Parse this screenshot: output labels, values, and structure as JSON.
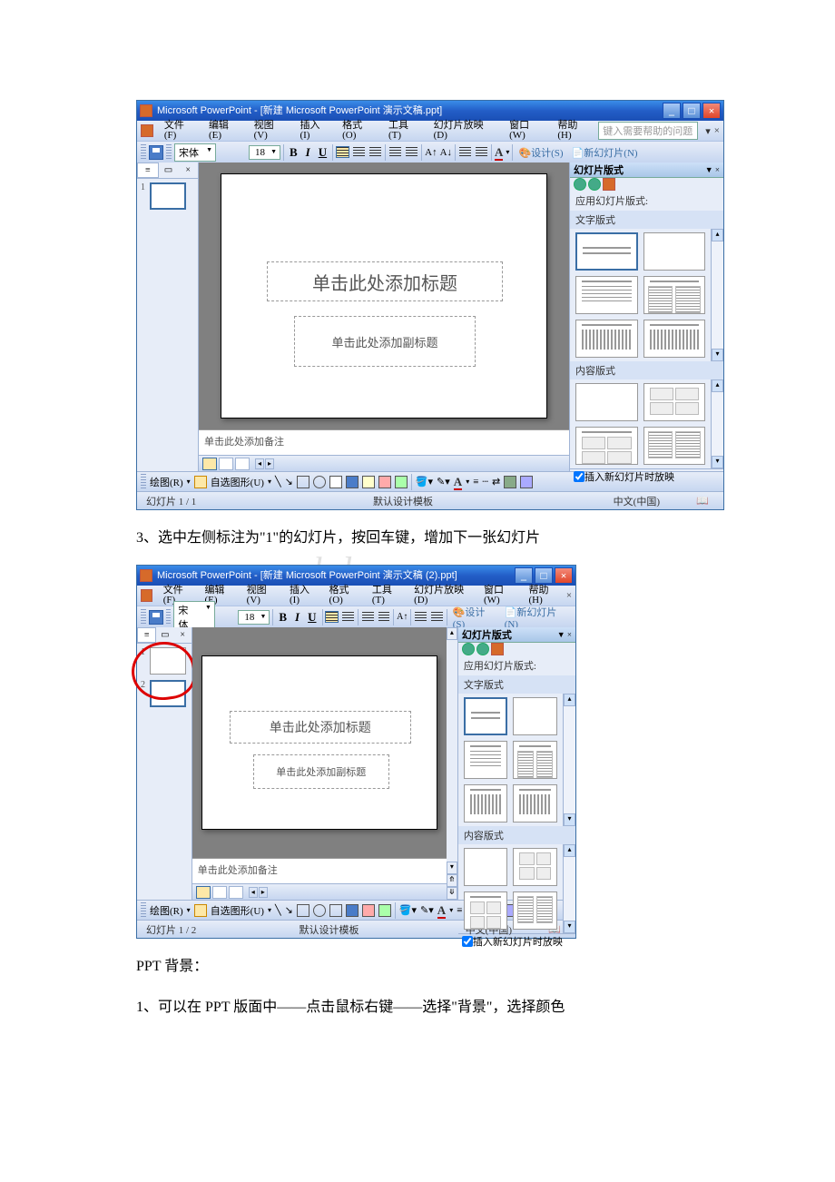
{
  "watermark": "www.bdocx.com",
  "body": {
    "line1": "3、选中左侧标注为\"1\"的幻灯片，按回车键，增加下一张幻灯片",
    "line2": "PPT 背景：",
    "line3": "1、可以在 PPT 版面中——点击鼠标右键——选择\"背景\"，选择颜色"
  },
  "ppt1": {
    "title": "Microsoft PowerPoint - [新建 Microsoft PowerPoint 演示文稿.ppt]",
    "menus": [
      "文件(F)",
      "编辑(E)",
      "视图(V)",
      "插入(I)",
      "格式(O)",
      "工具(T)",
      "幻灯片放映(D)",
      "窗口(W)",
      "帮助(H)"
    ],
    "help_placeholder": "键入需要帮助的问题",
    "font_name": "宋体",
    "font_size": "18",
    "design_btn": "设计(S)",
    "newslide_btn": "新幻灯片(N)",
    "taskpane_title": "幻灯片版式",
    "apply_label": "应用幻灯片版式:",
    "section_text": "文字版式",
    "section_content": "内容版式",
    "insert_check": "插入新幻灯片时放映",
    "thumb1_num": "1",
    "slide_title_ph": "单击此处添加标题",
    "slide_sub_ph": "单击此处添加副标题",
    "notes_ph": "单击此处添加备注",
    "draw_label": "绘图(R)",
    "autoshape_label": "自选图形(U)",
    "status_slide": "幻灯片 1 / 1",
    "status_template": "默认设计模板",
    "status_lang": "中文(中国)"
  },
  "ppt2": {
    "title": "Microsoft PowerPoint - [新建 Microsoft PowerPoint 演示文稿 (2).ppt]",
    "menus": [
      "文件(F)",
      "编辑(E)",
      "视图(V)",
      "插入(I)",
      "格式(O)",
      "工具(T)",
      "幻灯片放映(D)",
      "窗口(W)",
      "帮助(H)"
    ],
    "font_name": "宋体",
    "font_size": "18",
    "design_btn": "设计(S)",
    "newslide_btn": "新幻灯片(N)",
    "taskpane_title": "幻灯片版式",
    "apply_label": "应用幻灯片版式:",
    "section_text": "文字版式",
    "section_content": "内容版式",
    "insert_check": "插入新幻灯片时放映",
    "thumb1_num": "1",
    "thumb2_num": "2",
    "slide_title_ph": "单击此处添加标题",
    "slide_sub_ph": "单击此处添加副标题",
    "notes_ph": "单击此处添加备注",
    "draw_label": "绘图(R)",
    "autoshape_label": "自选图形(U)",
    "status_slide": "幻灯片 1 / 2",
    "status_template": "默认设计模板",
    "status_lang": "中文(中国)"
  }
}
